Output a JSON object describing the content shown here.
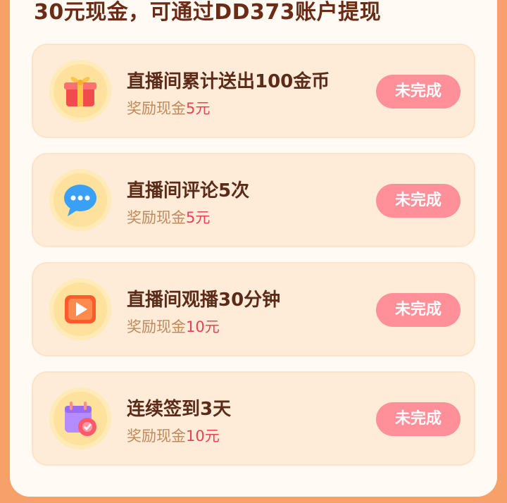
{
  "header": {
    "text": "30元现金，可通过DD373账户提现"
  },
  "tasks": [
    {
      "title": "直播间累计送出100金币",
      "reward_label": "奖励现金",
      "reward_amount": "5元",
      "status": "未完成",
      "icon": "gift-icon"
    },
    {
      "title": "直播间评论5次",
      "reward_label": "奖励现金",
      "reward_amount": "5元",
      "status": "未完成",
      "icon": "chat-bubble-icon"
    },
    {
      "title": "直播间观播30分钟",
      "reward_label": "奖励现金",
      "reward_amount": "10元",
      "status": "未完成",
      "icon": "play-video-icon"
    },
    {
      "title": "连续签到3天",
      "reward_label": "奖励现金",
      "reward_amount": "10元",
      "status": "未完成",
      "icon": "calendar-checkin-icon"
    }
  ],
  "colors": {
    "background": "#f7a06a",
    "card": "#ffecd8",
    "title": "#5b2a19",
    "reward_amount": "#ee3f55",
    "button": "#ff8f99"
  }
}
